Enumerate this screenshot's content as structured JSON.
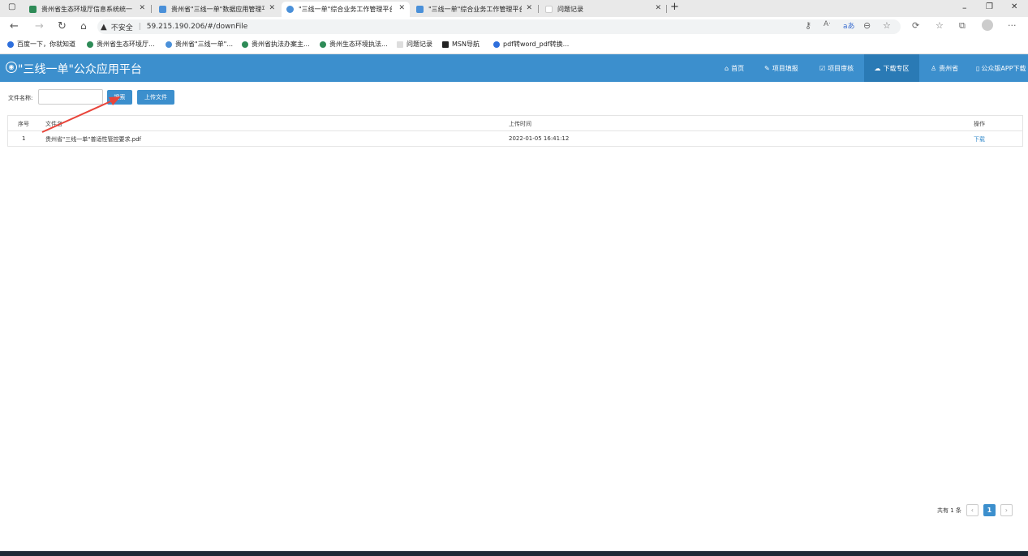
{
  "browser": {
    "tabs": [
      {
        "title": "贵州省生态环境厅信息系统统一",
        "icon_color": "#2e8b57",
        "active": false
      },
      {
        "title": "贵州省\"三线一单\"数据应用管理平",
        "icon_color": "#4a90d9",
        "active": false
      },
      {
        "title": "\"三线一单\"综合业务工作管理平台",
        "icon_color": "#4a90d9",
        "active": true
      },
      {
        "title": "\"三线一单\"综合业务工作管理平台",
        "icon_color": "#4a90d9",
        "active": false
      },
      {
        "title": "问题记录",
        "icon_color": "#cccccc",
        "active": false
      }
    ],
    "security_label": "不安全",
    "url": "59.215.190.206/#/downFile",
    "bookmarks": [
      {
        "label": "百度一下，你就知道",
        "color": "#2e6fdc"
      },
      {
        "label": "贵州省生态环境厅...",
        "color": "#2e8b57"
      },
      {
        "label": "贵州省\"三线一单\"...",
        "color": "#4a90d9"
      },
      {
        "label": "贵州省执法办案主...",
        "color": "#2e8b57"
      },
      {
        "label": "贵州生态环境执法...",
        "color": "#2e8b57"
      },
      {
        "label": "问题记录",
        "color": "#cccccc"
      },
      {
        "label": "MSN导航",
        "color": "#222222"
      },
      {
        "label": "pdf转word_pdf转换...",
        "color": "#2e6fdc"
      }
    ]
  },
  "header": {
    "title": "\"三线一单\"公众应用平台",
    "nav": [
      {
        "label": "首页",
        "icon": "⌂"
      },
      {
        "label": "项目填报",
        "icon": "✎"
      },
      {
        "label": "项目审核",
        "icon": "☑"
      },
      {
        "label": "下载专区",
        "icon": "☁"
      },
      {
        "label": "贵州省",
        "icon": "♙"
      },
      {
        "label": "公众版APP下载",
        "icon": "▯"
      }
    ],
    "color": "#3c8fcd"
  },
  "search": {
    "label": "文件名称:",
    "value": "",
    "search_button": "搜索",
    "upload_button": "上传文件"
  },
  "table": {
    "columns": [
      "序号",
      "文件名",
      "上传时间",
      "操作"
    ],
    "rows": [
      {
        "index": "1",
        "name": "贵州省\"三线一单\"普适性管控要求.pdf",
        "time": "2022-01-05 16:41:12",
        "action": "下载"
      }
    ]
  },
  "pagination": {
    "total_text": "共有 1 条",
    "prev": "‹",
    "current": "1",
    "next": "›"
  },
  "annotation": {
    "color": "#e8443a"
  }
}
